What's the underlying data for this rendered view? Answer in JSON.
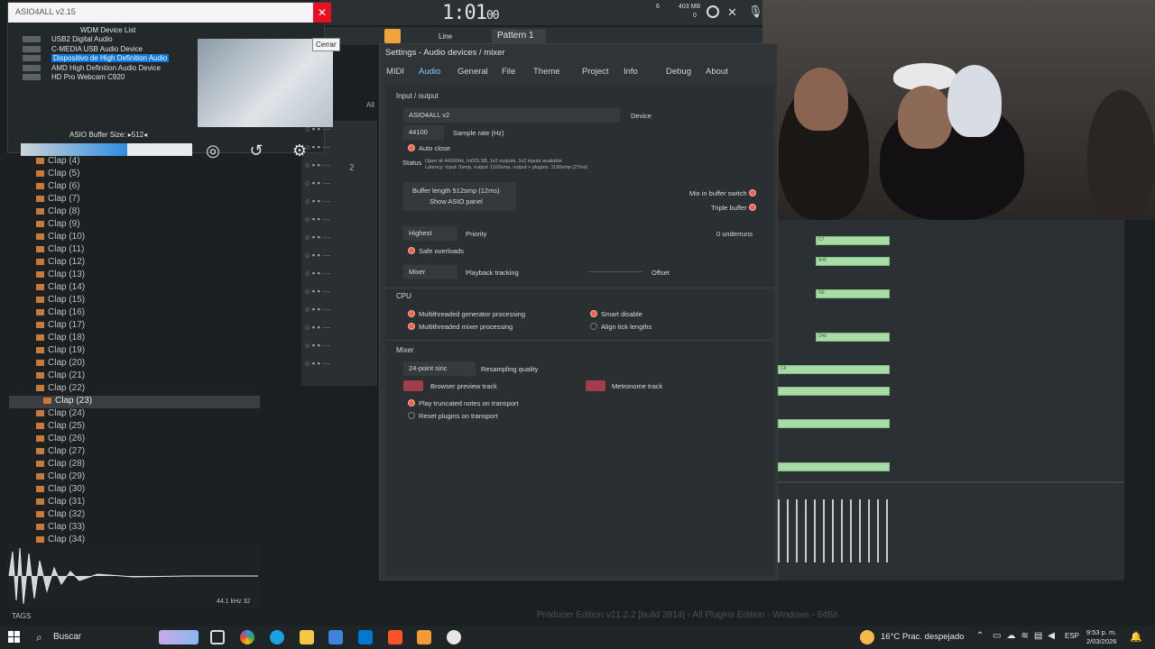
{
  "asio": {
    "title": "ASIO4ALL v2.15",
    "close_tooltip": "Cerrar",
    "list_header": "WDM Device List",
    "devices": [
      "USB2 Digital Audio",
      "C-MEDIA USB Audio Device",
      "Dispositivo de High Definition Audio",
      "AMD High Definition Audio Device",
      "HD Pro Webcam C920"
    ],
    "selected_device_index": 2,
    "buffer_label": "ASIO Buffer Size: ▸512◂",
    "buffer_level": 0.62
  },
  "toolbar": {
    "time_main": "1:01",
    "time_sub": "00",
    "pattern": "Pattern 1",
    "tool_mode": "Line",
    "memory": "403 MB",
    "cpu_num": "6",
    "poly": "0"
  },
  "browser": {
    "items": [
      "Clap (4)",
      "Clap (5)",
      "Clap (6)",
      "Clap (7)",
      "Clap (8)",
      "Clap (9)",
      "Clap (10)",
      "Clap (11)",
      "Clap (12)",
      "Clap (13)",
      "Clap (14)",
      "Clap (15)",
      "Clap (16)",
      "Clap (17)",
      "Clap (18)",
      "Clap (19)",
      "Clap (20)",
      "Clap (21)",
      "Clap (22)",
      "Clap (23)",
      "Clap (24)",
      "Clap (25)",
      "Clap (26)",
      "Clap (27)",
      "Clap (28)",
      "Clap (29)",
      "Clap (30)",
      "Clap (31)",
      "Clap (32)",
      "Clap (33)",
      "Clap (34)"
    ],
    "selected_index": 19,
    "tags_label": "TAGS",
    "sample_info": "44.1 kHz 32"
  },
  "settings": {
    "title": "Settings - Audio devices / mixer",
    "tabs": [
      "MIDI",
      "Audio",
      "General",
      "File",
      "Theme",
      "Project",
      "Info",
      "Debug",
      "About"
    ],
    "active_tab": 1,
    "input_output": "Input / output",
    "device_value": "ASIO4ALL v2",
    "device_label": "Device",
    "sample_rate_value": "44100",
    "sample_rate_label": "Sample rate (Hz)",
    "auto_close": "Auto close",
    "status_label": "Status",
    "status_line1": "Open at 44100Hz, Int32LSB, 1x2 outputs, 1x2 inputs available",
    "status_line2": "Latency: input: 0smp, output: 1102smp, output + plugins: 1190smp (27ms)",
    "buffer_length": "Buffer length 512smp (12ms)",
    "show_asio": "Show ASIO panel",
    "mix_in_buffer": "Mix in buffer switch",
    "triple_buffer": "Triple buffer",
    "priority_value": "Highest",
    "priority_label": "Priority",
    "underruns": "0 underruns",
    "safe_overloads": "Safe overloads",
    "playback_value": "Mixer",
    "playback_label": "Playback tracking",
    "offset_label": "Offset",
    "cpu_section": "CPU",
    "cpu_opt1": "Multithreaded generator processing",
    "cpu_opt2": "Multithreaded mixer processing",
    "cpu_opt3": "Smart disable",
    "cpu_opt4": "Align tick lengths",
    "mixer_section": "Mixer",
    "resampling_value": "24-point sinc",
    "resampling_label": "Resampling quality",
    "browser_preview": "Browser preview track",
    "metronome_track": "Metronome track",
    "play_truncated": "Play truncated notes on transport",
    "reset_plugins": "Reset plugins on transport"
  },
  "piano_roll": {
    "notes": [
      "C7",
      "A#6",
      "G6",
      "D#6",
      "C6"
    ]
  },
  "footer": {
    "edition": "Producer Edition v21.2.2 [build 3914] - All Plugins Edition - Windows - 64Bit"
  },
  "taskbar": {
    "search": "Buscar",
    "weather": "16°C  Prac. despejado",
    "lang": "ESP",
    "time": "9:53 p. m.",
    "date": "2/03/2026"
  },
  "channel": {
    "all_label": "All",
    "step_value": "2"
  }
}
